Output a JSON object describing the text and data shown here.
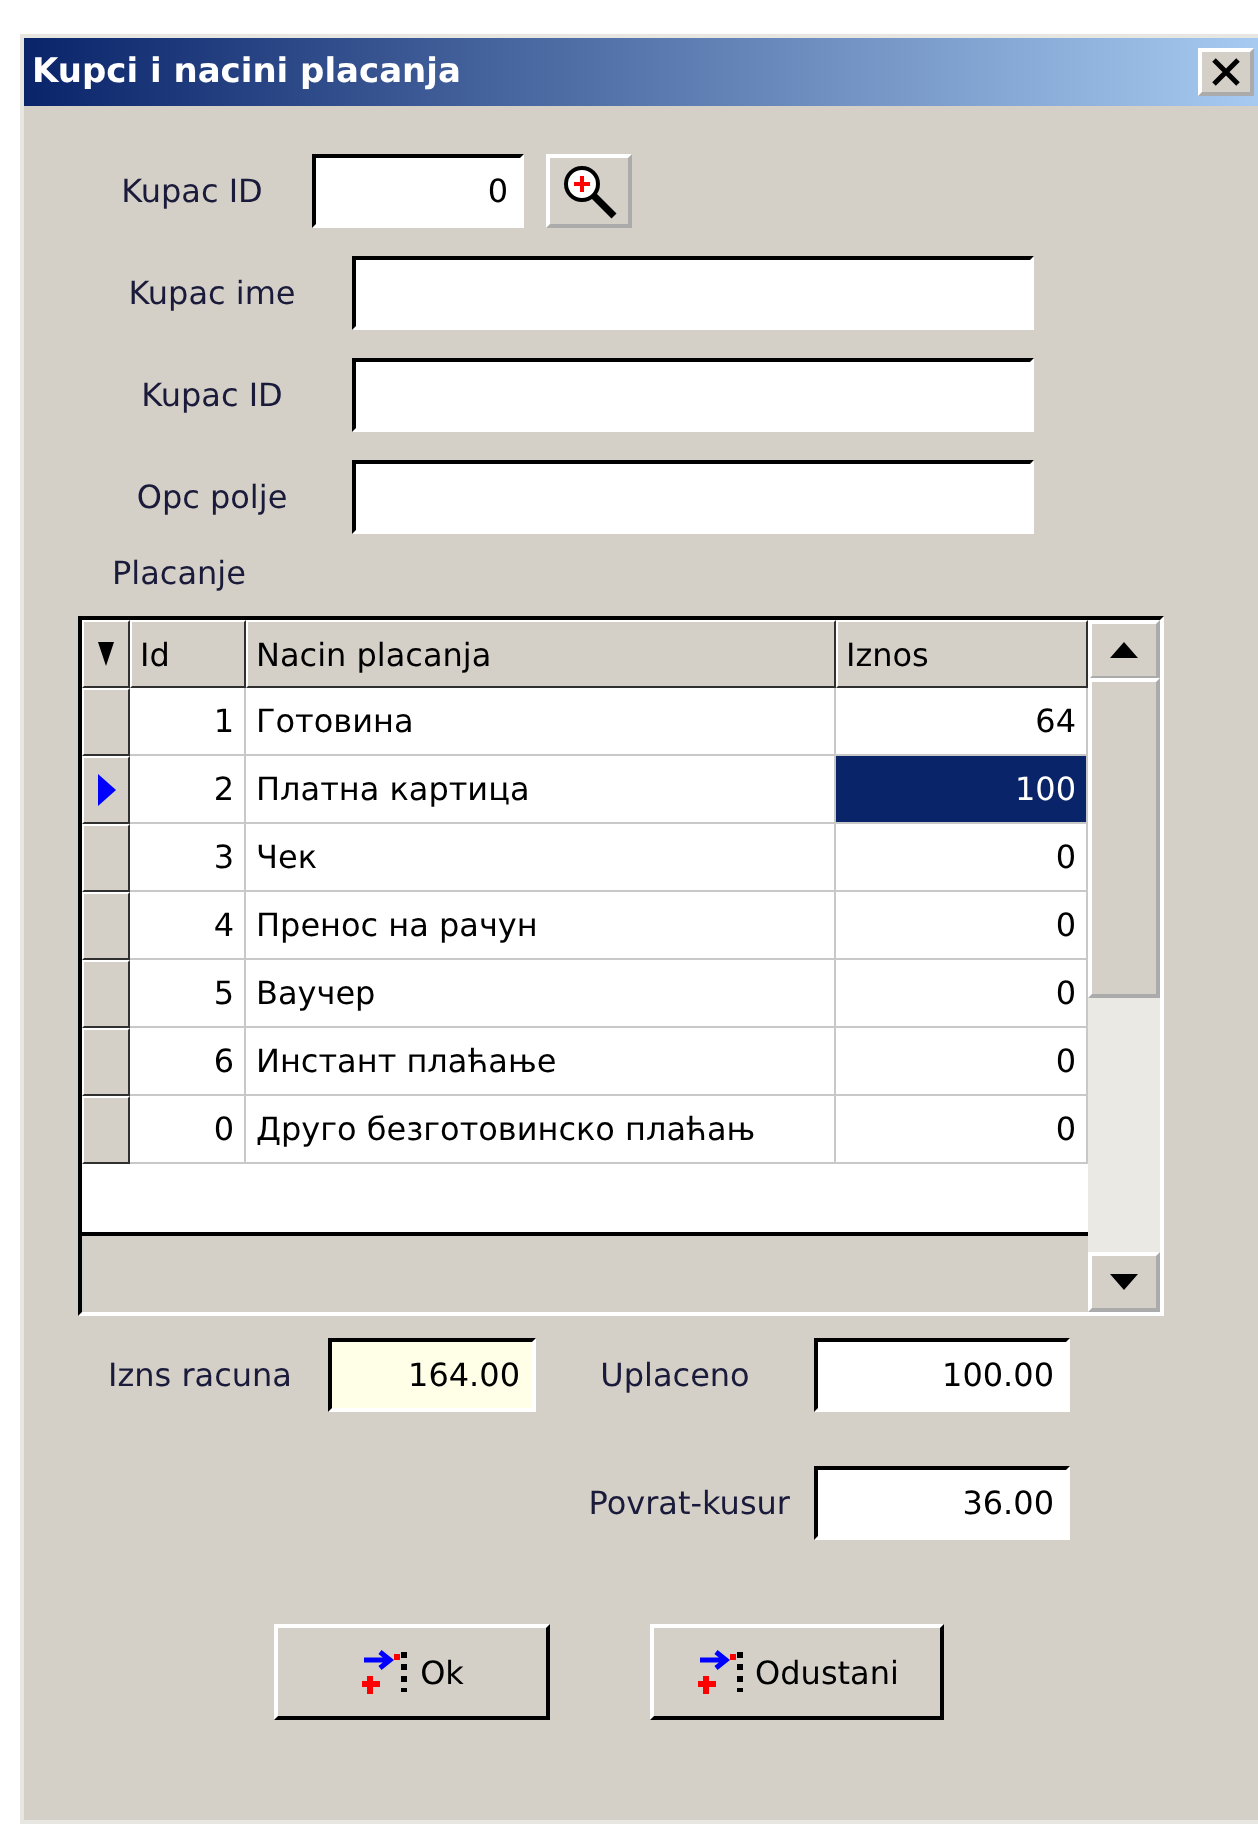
{
  "window": {
    "title": "Kupci i nacini placanja"
  },
  "fields": [
    {
      "label": "Kupac ID",
      "value": "0",
      "kind": "lookup"
    },
    {
      "label": "Kupac ime",
      "kind": "text"
    },
    {
      "label": "Kupac ID",
      "kind": "text"
    },
    {
      "label": "Opc polje",
      "kind": "text"
    }
  ],
  "payments": {
    "label": "Placanje",
    "columns": [
      "Id",
      "Nacin placanja",
      "Iznos"
    ],
    "rows": [
      {
        "id": "1",
        "method": "Готовина",
        "amount": "64",
        "selected": false
      },
      {
        "id": "2",
        "method": "Платна картица",
        "amount": "100",
        "selected": true
      },
      {
        "id": "3",
        "method": "Чек",
        "amount": "0",
        "selected": false
      },
      {
        "id": "4",
        "method": "Пренос на рачун",
        "amount": "0",
        "selected": false
      },
      {
        "id": "5",
        "method": "Ваучер",
        "amount": "0",
        "selected": false
      },
      {
        "id": "6",
        "method": "Инстант плаћање",
        "amount": "0",
        "selected": false
      },
      {
        "id": "0",
        "method": "Друго безготовинско плаћањ",
        "amount": "0",
        "selected": false
      }
    ]
  },
  "totals": {
    "invoice": {
      "label": "Izns racuna",
      "value": "164.00"
    },
    "paid": {
      "label": "Uplaceno",
      "value": "100.00"
    },
    "change": {
      "label": "Povrat-kusur",
      "value": "36.00"
    }
  },
  "buttons": [
    "Ok",
    "Odustani"
  ]
}
